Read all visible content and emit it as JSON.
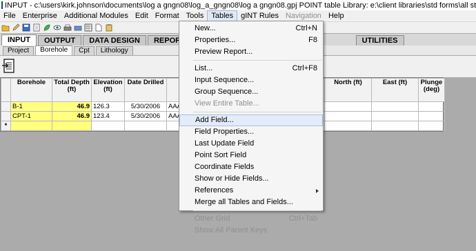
{
  "titlebar": {
    "text": "INPUT - c:\\users\\kirk.johnson\\documents\\log a gngn08\\log_a_gngn08\\log a gngn08.gpj  POINT table  Library: e:\\client libraries\\std forms\\all standard forms.glb"
  },
  "menubar": {
    "items": [
      "File",
      "Enterprise",
      "Additional Modules",
      "Edit",
      "Format",
      "Tools",
      "Tables",
      "gINT Rules",
      "Navigation",
      "Help"
    ]
  },
  "main_tabs": [
    "INPUT",
    "OUTPUT",
    "DATA DESIGN",
    "REPORT DESI",
    "UTILITIES"
  ],
  "sub_tabs": [
    "Project",
    "Borehole",
    "Cpt",
    "Lithology"
  ],
  "grid": {
    "headers": [
      "Borehole",
      "Total Depth (ft)",
      "Elevation (ft)",
      "Date Drilled",
      "",
      "North (ft)",
      "East (ft)",
      "Plunge (deg)"
    ],
    "rows": [
      {
        "marker": "",
        "borehole": "B-1",
        "depth": "46.9",
        "elevation": "126.3",
        "date": "5/30/2006",
        "extra": "AAA"
      },
      {
        "marker": "",
        "borehole": "CPT-1",
        "depth": "46.9",
        "elevation": "123.4",
        "date": "5/30/2006",
        "extra": "AAA"
      },
      {
        "marker": "*",
        "borehole": "",
        "depth": "",
        "elevation": "",
        "date": "",
        "extra": ""
      }
    ]
  },
  "tables_menu": {
    "items": [
      {
        "label": "New...",
        "shortcut": "Ctrl+N"
      },
      {
        "label": "Properties...",
        "shortcut": "F8"
      },
      {
        "label": "Preview Report..."
      },
      {
        "label": "List...",
        "shortcut": "Ctrl+F8"
      },
      {
        "label": "Input Sequence..."
      },
      {
        "label": "Group Sequence..."
      },
      {
        "label": "View Entire Table..."
      },
      {
        "label": "Add Field..."
      },
      {
        "label": "Field Properties..."
      },
      {
        "label": "Last Update Field"
      },
      {
        "label": "Point Sort Field"
      },
      {
        "label": "Coordinate Fields"
      },
      {
        "label": "Show or Hide Fields..."
      },
      {
        "label": "References"
      },
      {
        "label": "Merge all Tables and Fields..."
      },
      {
        "label": "Other Grid",
        "shortcut": "Ctrl+Tab"
      },
      {
        "label": "Show All Parent Keys"
      }
    ]
  },
  "colors": {
    "yellow_cell": "#ffff80",
    "menu_highlight": "#e3ecf8"
  }
}
